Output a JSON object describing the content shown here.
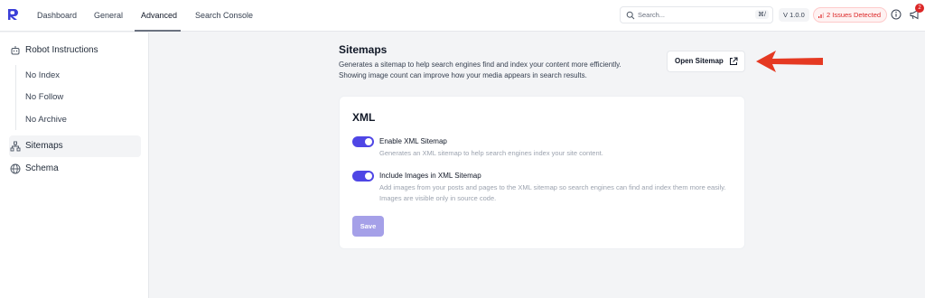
{
  "nav": {
    "tabs": [
      {
        "label": "Dashboard"
      },
      {
        "label": "General"
      },
      {
        "label": "Advanced",
        "active": true
      },
      {
        "label": "Search Console"
      }
    ]
  },
  "header": {
    "search_placeholder": "Search...",
    "search_shortcut": "⌘/",
    "version": "V 1.0.0",
    "issues": "2 Issues Detected",
    "notification_count": "2",
    "colors": {
      "accent": "#4f46e5",
      "danger": "#dc2626"
    }
  },
  "sidebar": {
    "robot": "Robot Instructions",
    "robot_items": [
      "No Index",
      "No Follow",
      "No Archive"
    ],
    "sitemaps": "Sitemaps",
    "schema": "Schema",
    "active": "Sitemaps"
  },
  "main": {
    "title": "Sitemaps",
    "description": "Generates a sitemap to help search engines find and index your content more efficiently. Showing image count can improve how your media appears in search results.",
    "open_button": "Open Sitemap",
    "card": {
      "title": "XML",
      "options": [
        {
          "label": "Enable XML Sitemap",
          "desc": "Generates an XML sitemap to help search engines index your site content.",
          "enabled": true
        },
        {
          "label": "Include Images in XML Sitemap",
          "desc": "Add images from your posts and pages to the XML sitemap so search engines can find and index them more easily. Images are visible only in source code.",
          "enabled": true
        }
      ],
      "save": "Save"
    }
  }
}
